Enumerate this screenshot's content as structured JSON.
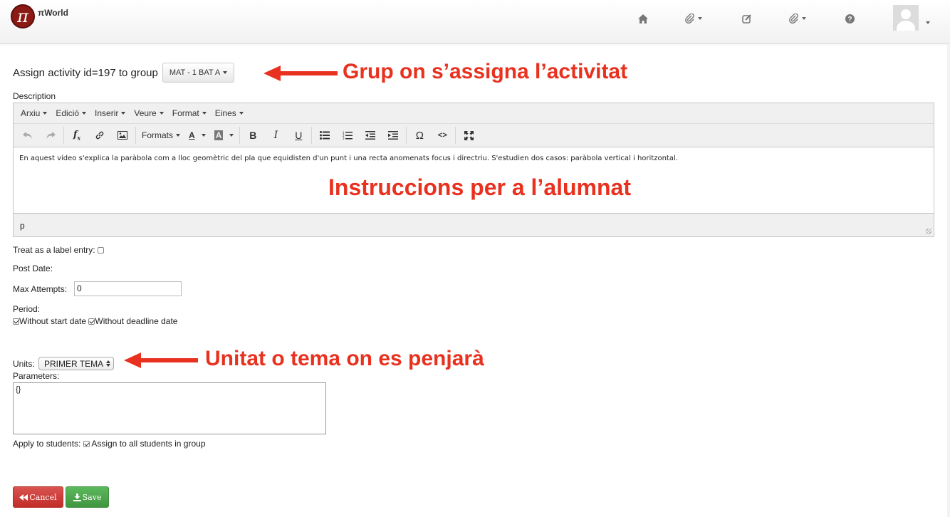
{
  "navbar": {
    "brand_logo": "π",
    "brand_name": "πWorld",
    "icons": [
      "home-icon",
      "paperclip-icon",
      "edit-icon",
      "paperclip-icon",
      "question-circle-icon",
      "user-avatar-icon"
    ]
  },
  "page": {
    "title": "Assign activity id=197 to group",
    "group_selector": "MAT - 1 BAT A",
    "description_label": "Description"
  },
  "editor": {
    "menu": [
      "Arxiu",
      "Edició",
      "Inserir",
      "Veure",
      "Format",
      "Eines"
    ],
    "toolbar_formats": "Formats",
    "toolbar_text_color": "A",
    "toolbar_bg_color": "A",
    "content": "En aquest vídeo s'explica la paràbola com a lloc geomètric del pla que equidisten d'un punt i una recta anomenats focus i directriu. S'estudien dos casos: paràbola vertical i horitzontal.",
    "status_path": "p"
  },
  "form": {
    "label_entry": "Treat as a label entry:",
    "post_date": "Post Date:",
    "max_attempts_label": "Max Attempts:",
    "max_attempts_value": "0",
    "period_label": "Period:",
    "without_start": "Without start date",
    "without_deadline": "Without deadline date",
    "units_label": "Units:",
    "units_value": "PRIMER TEMA",
    "parameters_label": "Parameters:",
    "parameters_value": "{}",
    "apply_label": "Apply to students:",
    "assign_all": "Assign to all students in group"
  },
  "buttons": {
    "cancel": "Cancel",
    "save": "Save"
  },
  "annotations": {
    "group": "Grup on s’assigna l’activitat",
    "instructions": "Instruccions per a l’alumnat",
    "unit": "Unitat o tema on es penjarà"
  },
  "colors": {
    "annotation": "#e8311f",
    "cancel": "#d9534f",
    "save": "#5cb85c"
  }
}
